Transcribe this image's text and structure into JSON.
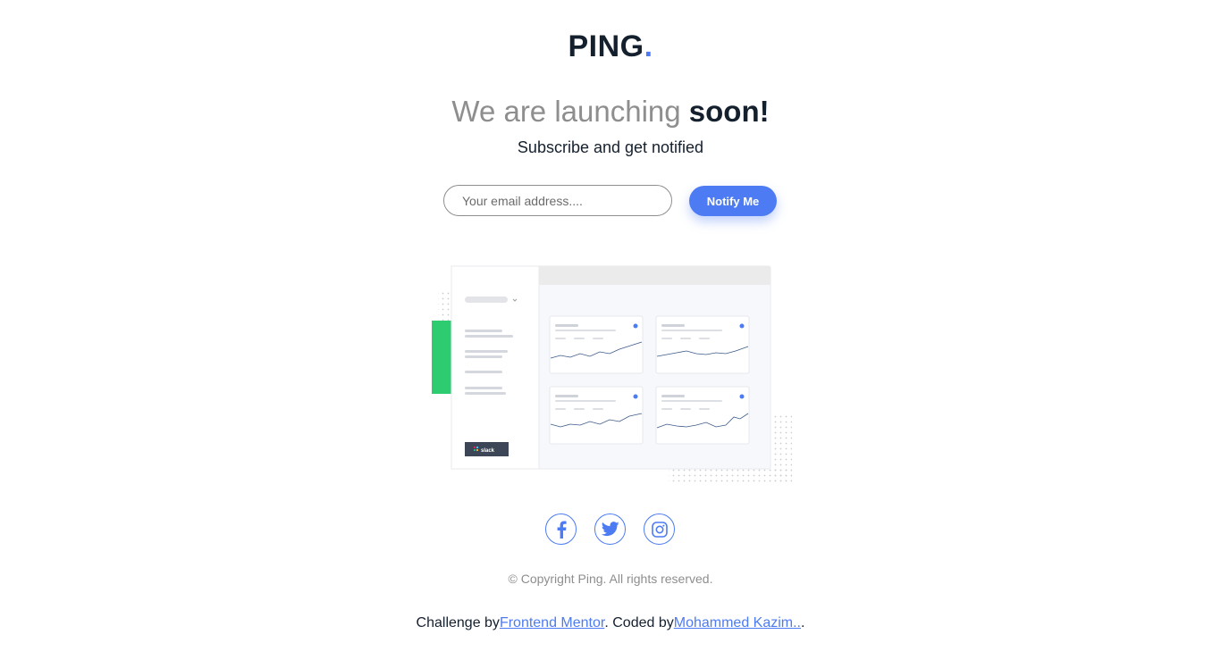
{
  "brand": {
    "name": "PING",
    "dot": "."
  },
  "headline": {
    "light": "We are launching",
    "bold": "soon!"
  },
  "subhead": "Subscribe and get notified",
  "form": {
    "email_placeholder": "Your email address....",
    "email_value": "",
    "notify_label": "Notify Me"
  },
  "illustration": {
    "badge_label": "slack"
  },
  "socials": [
    {
      "name": "facebook",
      "icon": "facebook-icon"
    },
    {
      "name": "twitter",
      "icon": "twitter-icon"
    },
    {
      "name": "instagram",
      "icon": "instagram-icon"
    }
  ],
  "footer": {
    "copyright": "© Copyright Ping. All rights reserved.",
    "challenge_prefix": "Challenge by",
    "challenge_link": "Frontend Mentor",
    "coded_prefix": ". Coded by",
    "coder_link": "Mohammed Kazim..",
    "suffix": "."
  },
  "colors": {
    "accent": "#4d7bf3",
    "dark": "#15202e",
    "gray": "#8e8e8e",
    "green": "#2ecc71"
  }
}
